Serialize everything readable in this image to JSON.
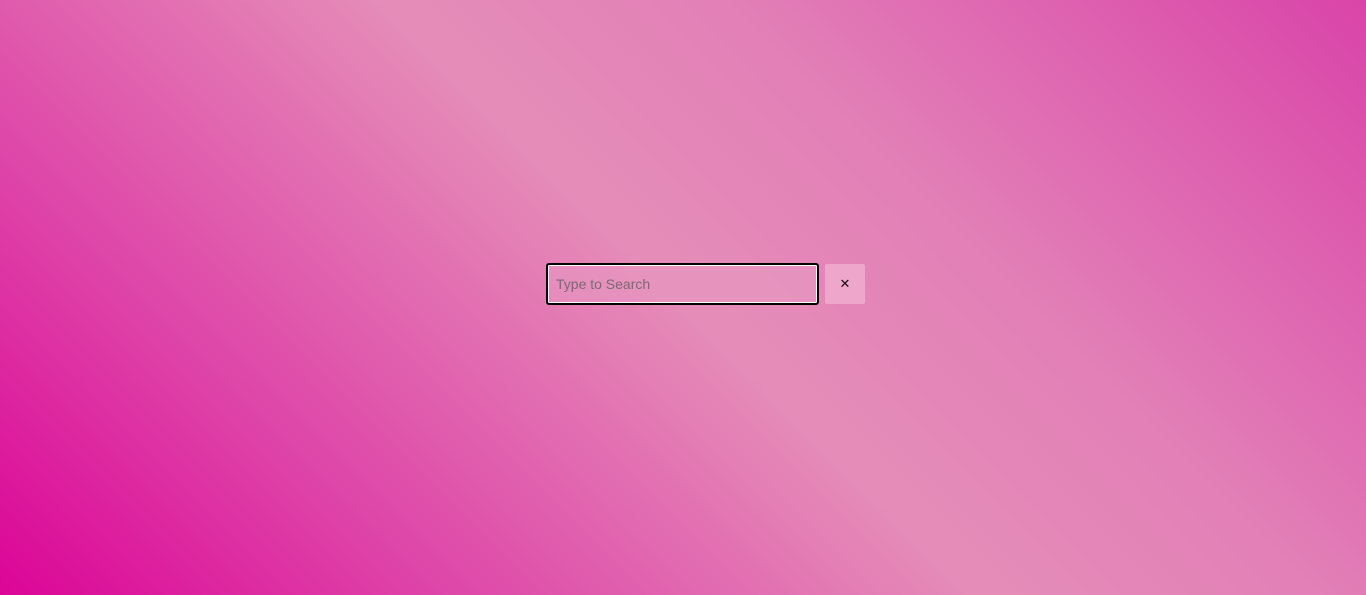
{
  "search": {
    "placeholder": "Type to Search",
    "value": ""
  },
  "clear_button": {
    "icon": "close-icon",
    "glyph": "✕"
  },
  "colors": {
    "gradient_start": "#dc0597",
    "gradient_mid": "#e58db8",
    "gradient_end": "#d944a8",
    "clear_button_bg": "#eea6cb",
    "input_border": "#000000"
  }
}
